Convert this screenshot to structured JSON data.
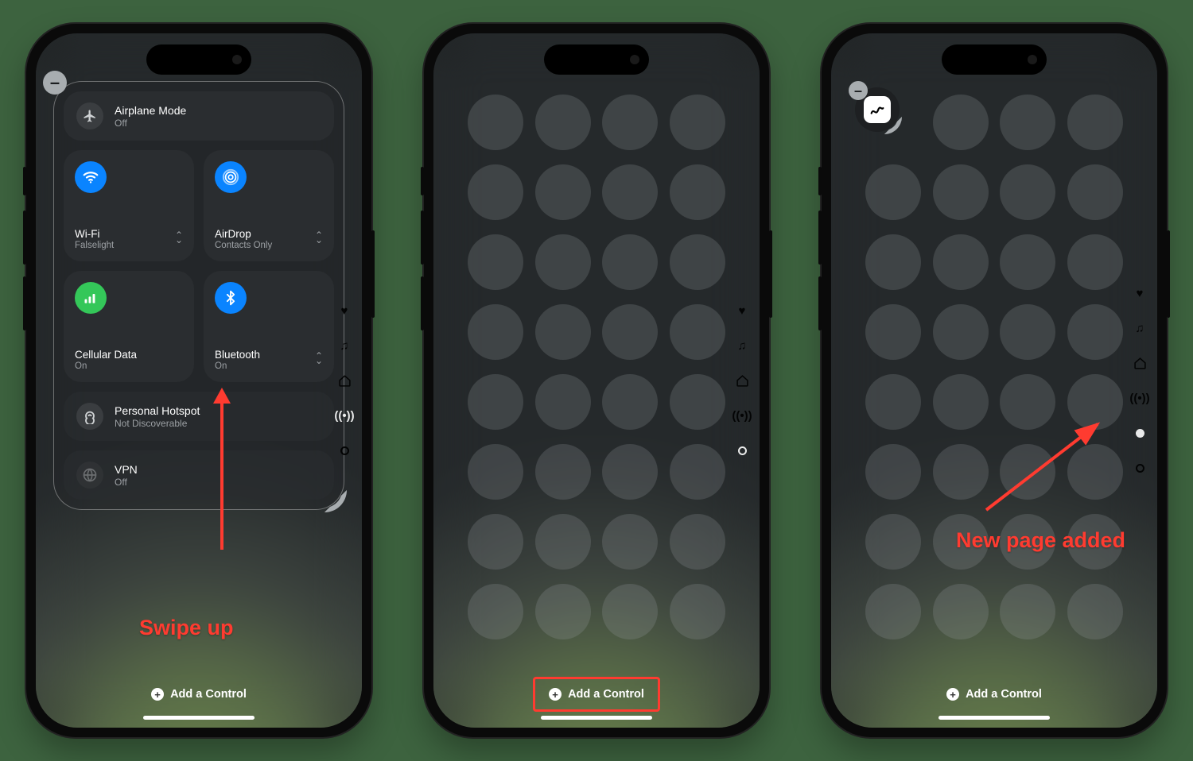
{
  "screen1": {
    "airplane": {
      "title": "Airplane Mode",
      "status": "Off"
    },
    "wifi": {
      "title": "Wi-Fi",
      "status": "Falselight"
    },
    "airdrop": {
      "title": "AirDrop",
      "status": "Contacts Only"
    },
    "cellular": {
      "title": "Cellular Data",
      "status": "On"
    },
    "bluetooth": {
      "title": "Bluetooth",
      "status": "On"
    },
    "hotspot": {
      "title": "Personal Hotspot",
      "status": "Not Discoverable"
    },
    "vpn": {
      "title": "VPN",
      "status": "Off"
    },
    "add_label": "Add a Control",
    "annotation": "Swipe up",
    "side_icons": [
      "heart",
      "music",
      "home",
      "antenna",
      "circle"
    ]
  },
  "screen2": {
    "add_label": "Add a Control",
    "side_icons": [
      "heart",
      "music",
      "home",
      "antenna",
      "ring"
    ]
  },
  "screen3": {
    "add_label": "Add a Control",
    "annotation": "New page added",
    "side_icons": [
      "heart",
      "music",
      "home",
      "antenna",
      "dot",
      "circle"
    ]
  }
}
